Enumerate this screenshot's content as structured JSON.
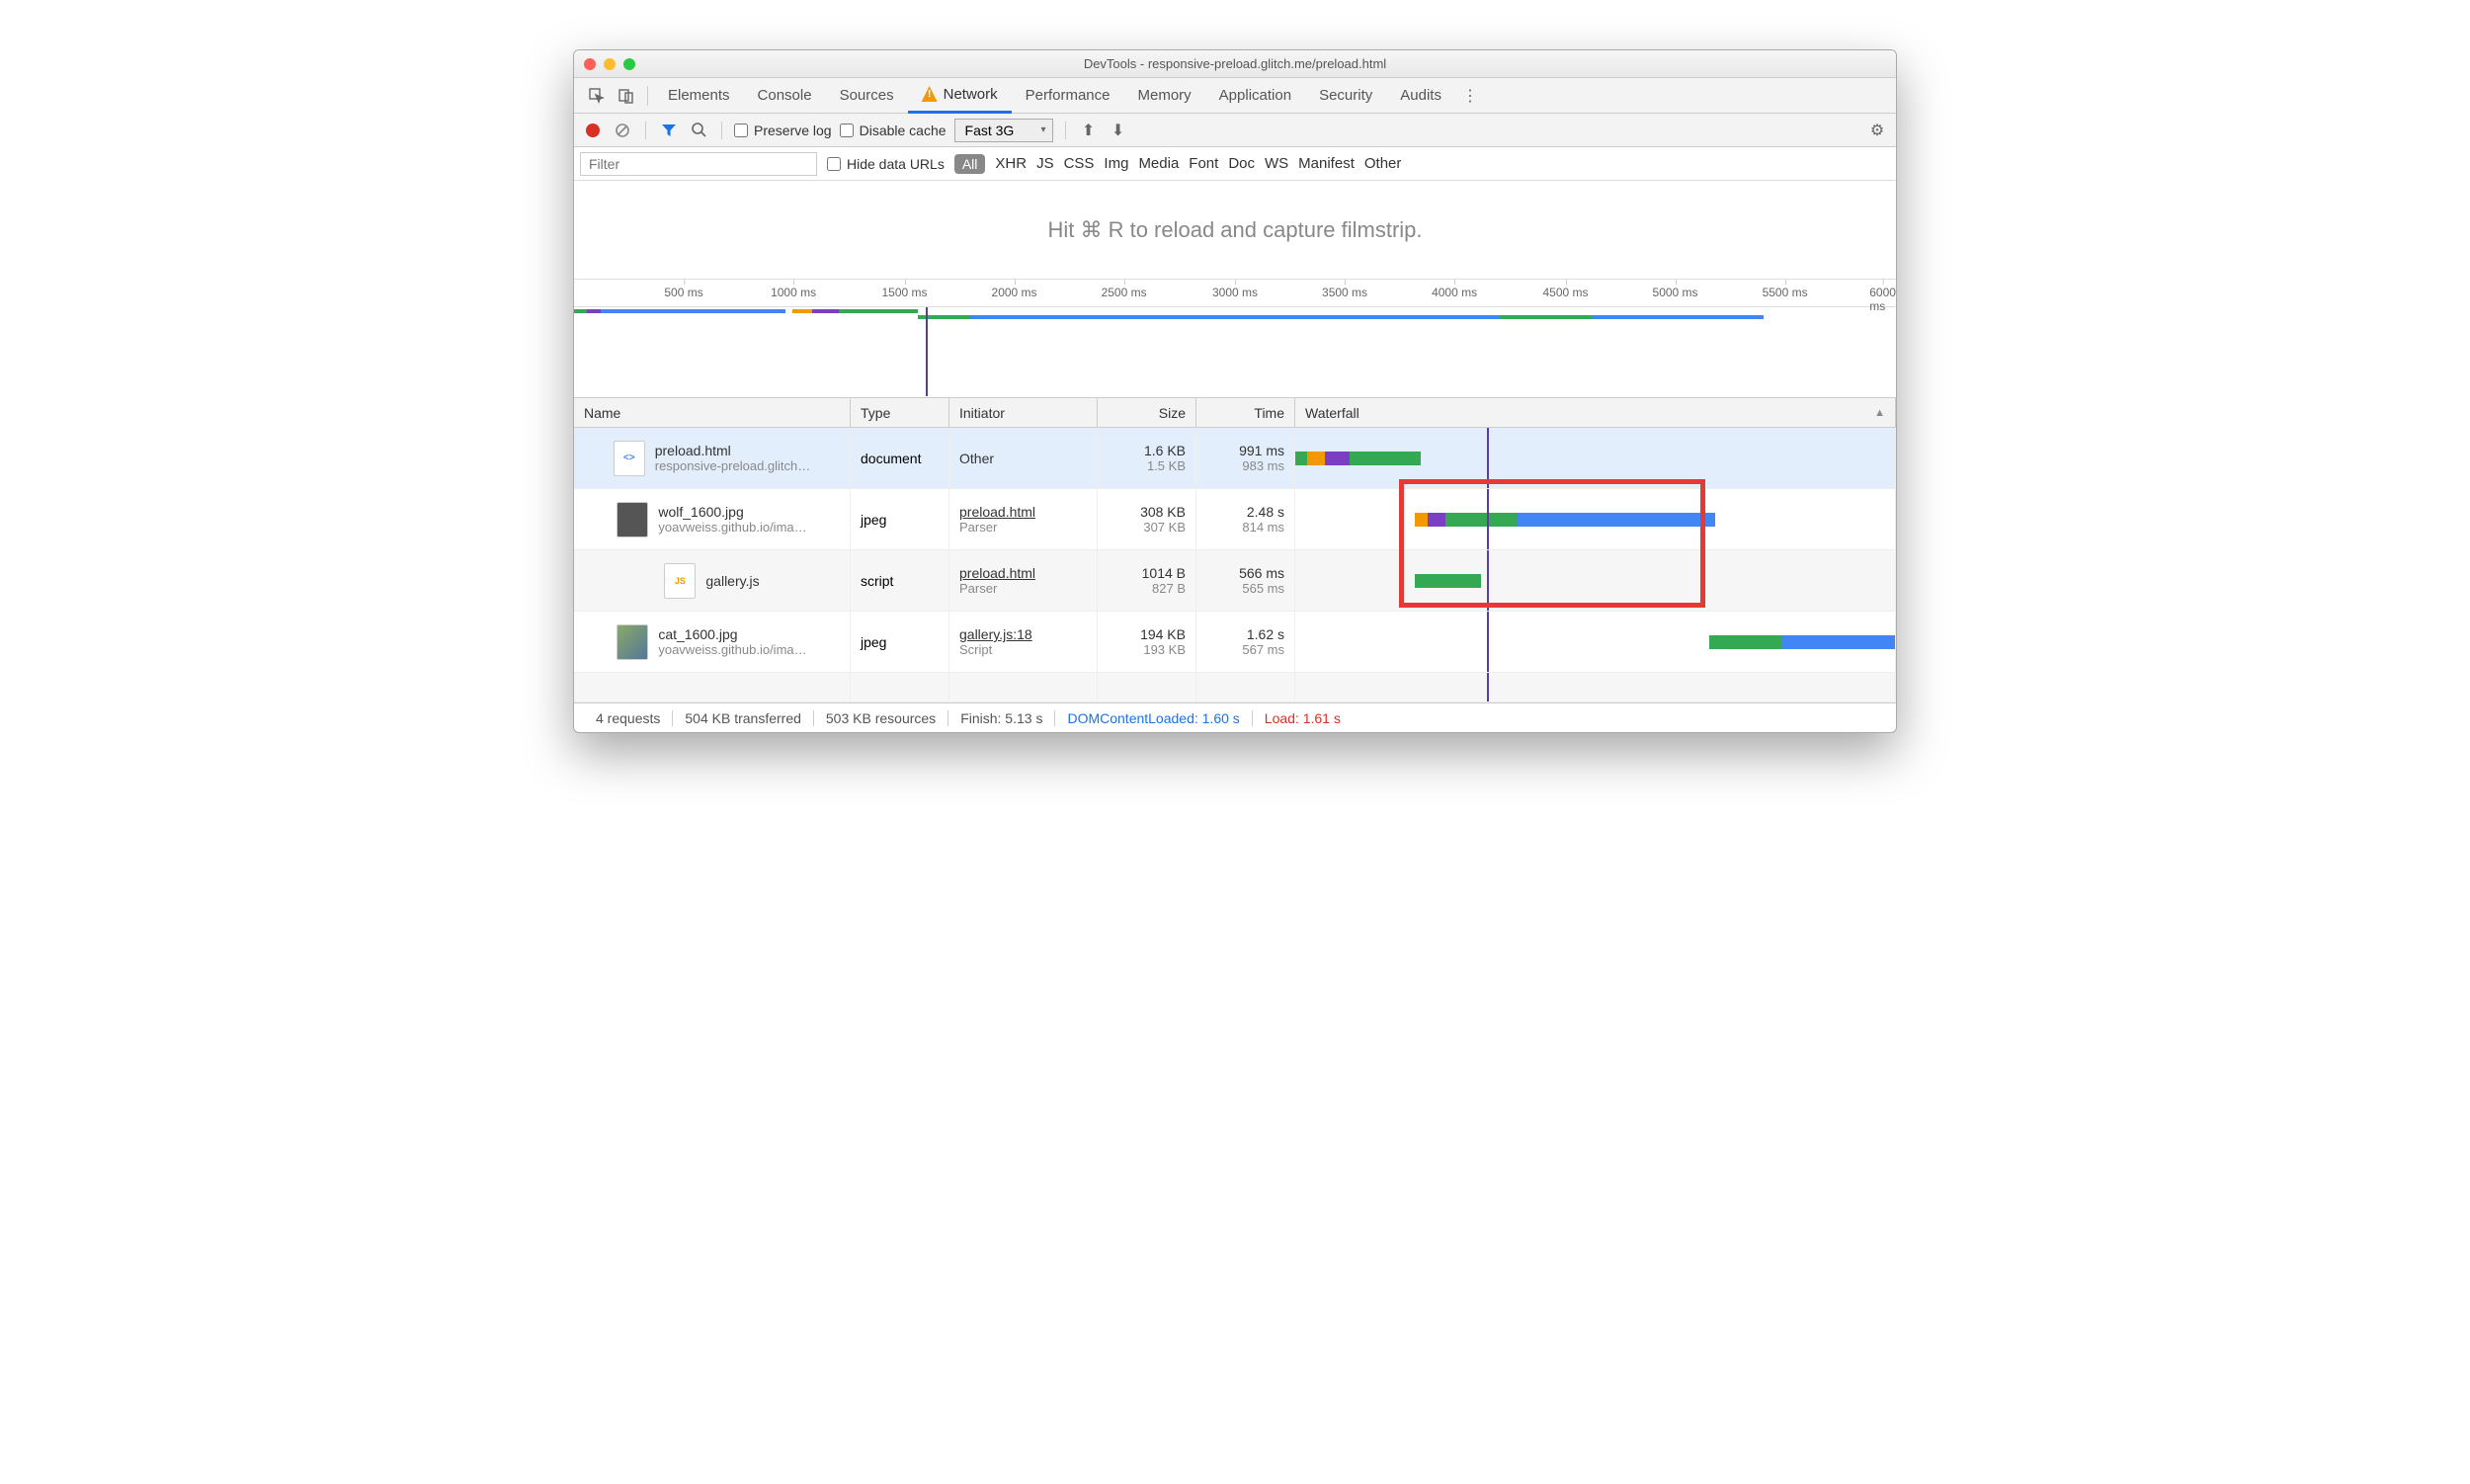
{
  "window": {
    "title": "DevTools - responsive-preload.glitch.me/preload.html"
  },
  "tabs": [
    "Elements",
    "Console",
    "Sources",
    "Network",
    "Performance",
    "Memory",
    "Application",
    "Security",
    "Audits"
  ],
  "activeTab": "Network",
  "toolbar": {
    "preserve_log": "Preserve log",
    "disable_cache": "Disable cache",
    "throttle": "Fast 3G"
  },
  "filterbar": {
    "placeholder": "Filter",
    "hide_data_urls": "Hide data URLs",
    "types": [
      "All",
      "XHR",
      "JS",
      "CSS",
      "Img",
      "Media",
      "Font",
      "Doc",
      "WS",
      "Manifest",
      "Other"
    ]
  },
  "banner": "Hit ⌘ R to reload and capture filmstrip.",
  "timeline_ticks": [
    "500 ms",
    "1000 ms",
    "1500 ms",
    "2000 ms",
    "2500 ms",
    "3000 ms",
    "3500 ms",
    "4000 ms",
    "4500 ms",
    "5000 ms",
    "5500 ms",
    "6000 ms"
  ],
  "columns": {
    "name": "Name",
    "type": "Type",
    "initiator": "Initiator",
    "size": "Size",
    "time": "Time",
    "waterfall": "Waterfall"
  },
  "rows": [
    {
      "name": "preload.html",
      "sub": "responsive-preload.glitch…",
      "type": "document",
      "init": "Other",
      "init_sub": "",
      "size": "1.6 KB",
      "size_sub": "1.5 KB",
      "time": "991 ms",
      "time_sub": "983 ms",
      "icon": "html"
    },
    {
      "name": "wolf_1600.jpg",
      "sub": "yoavweiss.github.io/ima…",
      "type": "jpeg",
      "init": "preload.html",
      "init_sub": "Parser",
      "size": "308 KB",
      "size_sub": "307 KB",
      "time": "2.48 s",
      "time_sub": "814 ms",
      "icon": "img"
    },
    {
      "name": "gallery.js",
      "sub": "",
      "type": "script",
      "init": "preload.html",
      "init_sub": "Parser",
      "size": "1014 B",
      "size_sub": "827 B",
      "time": "566 ms",
      "time_sub": "565 ms",
      "icon": "js"
    },
    {
      "name": "cat_1600.jpg",
      "sub": "yoavweiss.github.io/ima…",
      "type": "jpeg",
      "init": "gallery.js:18",
      "init_sub": "Script",
      "size": "194 KB",
      "size_sub": "193 KB",
      "time": "1.62 s",
      "time_sub": "567 ms",
      "icon": "img"
    }
  ],
  "status": {
    "requests": "4 requests",
    "transferred": "504 KB transferred",
    "resources": "503 KB resources",
    "finish": "Finish: 5.13 s",
    "dcl": "DOMContentLoaded: 1.60 s",
    "load": "Load: 1.61 s"
  }
}
